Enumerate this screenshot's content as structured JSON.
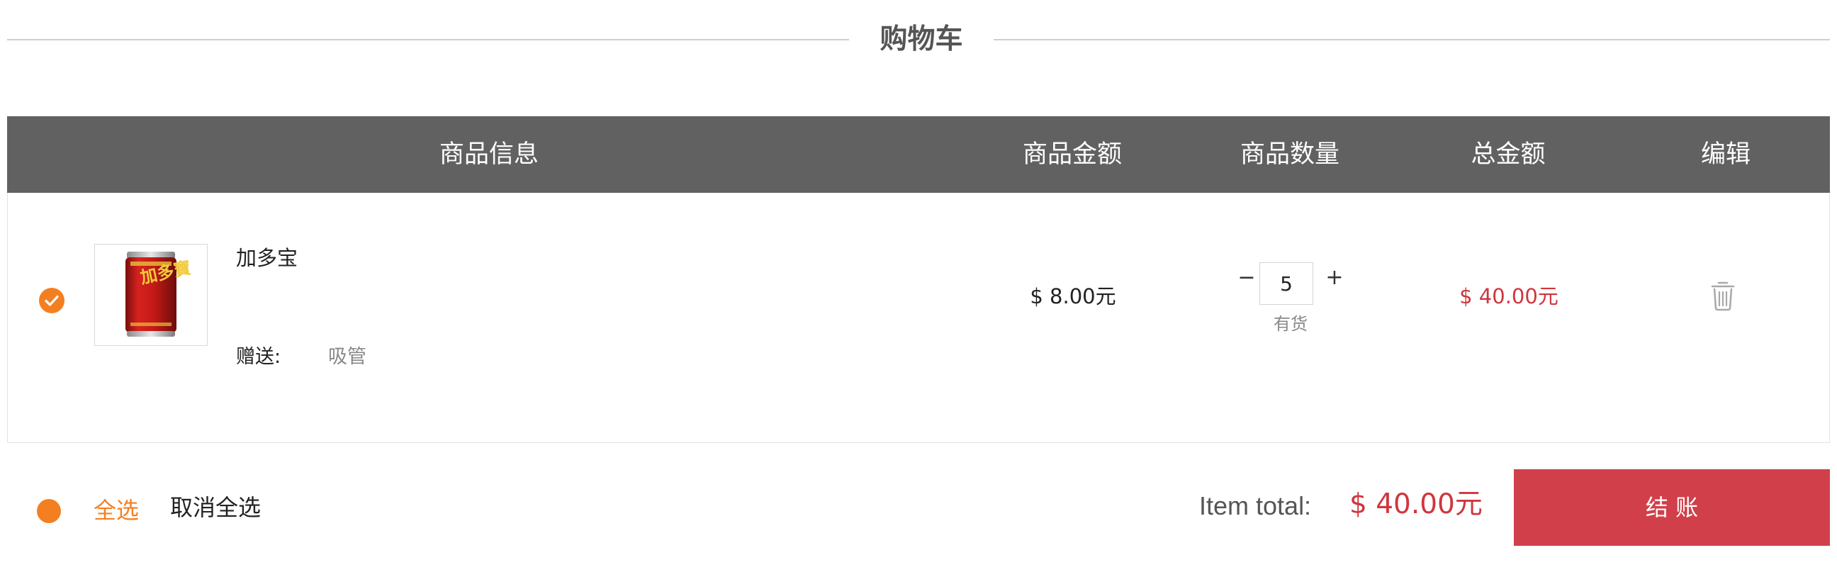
{
  "page": {
    "title": "购物车"
  },
  "table": {
    "headers": {
      "info": "商品信息",
      "price": "商品金额",
      "quantity": "商品数量",
      "total": "总金额",
      "edit": "编辑"
    }
  },
  "cart": {
    "items": [
      {
        "selected": true,
        "name": "加多宝",
        "gift_label": "赠送:",
        "gift_value": "吸管",
        "unit_price": "$ 8.00元",
        "quantity": "5",
        "stock_status": "有货",
        "total": "$ 40.00元",
        "product_image": "red-can-product-image",
        "image_text": "加多寶",
        "delete_icon": "trash-icon",
        "minus_label": "−",
        "plus_label": "+"
      }
    ]
  },
  "footer": {
    "select_all": "全选",
    "deselect_all": "取消全选",
    "item_total_label": "Item total:",
    "item_total_value": "$ 40.00元",
    "checkout_label": "结 账"
  },
  "colors": {
    "accent_orange": "#f47f20",
    "header_gray": "#616161",
    "price_red": "#d0363e",
    "checkout_red": "#d1404a"
  }
}
